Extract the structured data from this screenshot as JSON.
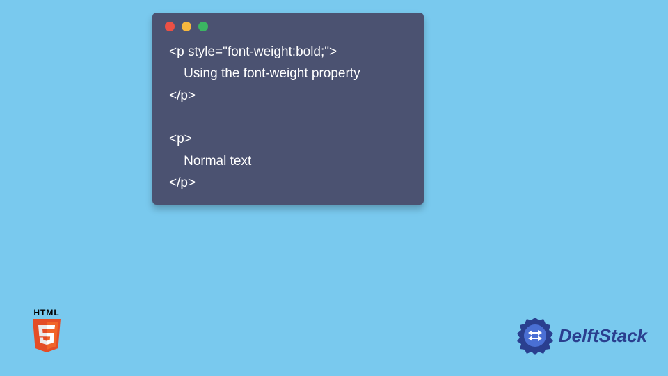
{
  "code_block": {
    "line1": "<p style=\"font-weight:bold;\">",
    "line2": "    Using the font-weight property",
    "line3": "</p>",
    "line4": "",
    "line5": "<p>",
    "line6": "    Normal text",
    "line7": "</p>"
  },
  "html5_badge": {
    "label": "HTML"
  },
  "delft_logo": {
    "brand": "DelftStack"
  }
}
